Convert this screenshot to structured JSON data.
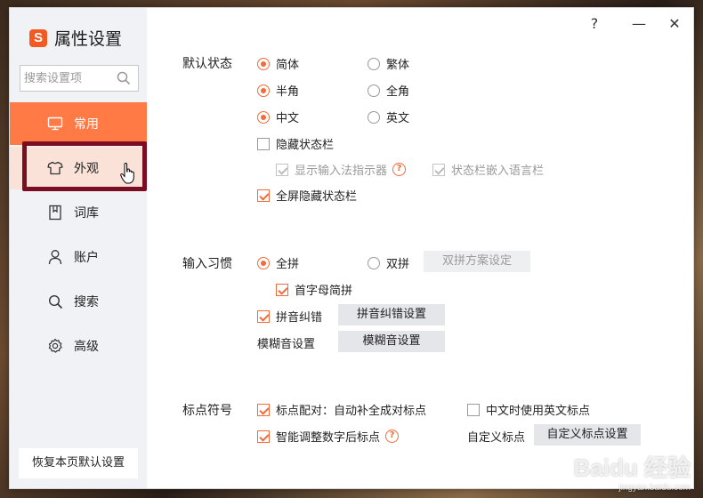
{
  "app": {
    "logo_letter": "S",
    "title": "属性设置"
  },
  "window_controls": {
    "help": "?",
    "minimize": "—",
    "close": "✕"
  },
  "sidebar": {
    "search_placeholder": "搜索设置项",
    "items": [
      {
        "label": "常用",
        "icon": "monitor-icon",
        "state": "active"
      },
      {
        "label": "外观",
        "icon": "shirt-icon",
        "state": "hover"
      },
      {
        "label": "词库",
        "icon": "book-icon",
        "state": "normal"
      },
      {
        "label": "账户",
        "icon": "user-icon",
        "state": "normal"
      },
      {
        "label": "搜索",
        "icon": "search-icon",
        "state": "normal"
      },
      {
        "label": "高级",
        "icon": "gear-icon",
        "state": "normal"
      }
    ],
    "restore_button": "恢复本页默认设置"
  },
  "default_state": {
    "label": "默认状态",
    "simplified": "简体",
    "traditional": "繁体",
    "half_width": "半角",
    "full_width": "全角",
    "chinese": "中文",
    "english": "英文",
    "hide_status_bar": "隐藏状态栏",
    "show_ime_indicator": "显示输入法指示器",
    "embed_language_bar": "状态栏嵌入语言栏",
    "fullscreen_hide_status_bar": "全屏隐藏状态栏"
  },
  "input_habit": {
    "label": "输入习惯",
    "full_pinyin": "全拼",
    "double_pinyin": "双拼",
    "double_pinyin_settings": "双拼方案设定",
    "initial_abbrev": "首字母简拼",
    "pinyin_correction": "拼音纠错",
    "pinyin_correction_settings": "拼音纠错设置",
    "fuzzy_label": "模糊音设置",
    "fuzzy_button": "模糊音设置"
  },
  "punctuation": {
    "label": "标点符号",
    "auto_pair": "标点配对：自动补全成对标点",
    "english_in_chinese": "中文时使用英文标点",
    "smart_adjust": "智能调整数字后标点",
    "custom_label": "自定义标点",
    "custom_button": "自定义标点设置"
  },
  "watermark": {
    "brand": "Baidu 经验",
    "url": "jingyan.baidu.com"
  },
  "colors": {
    "accent": "#f26b3a",
    "active_nav": "#ff7a45",
    "highlight_box": "#7a0d22"
  }
}
